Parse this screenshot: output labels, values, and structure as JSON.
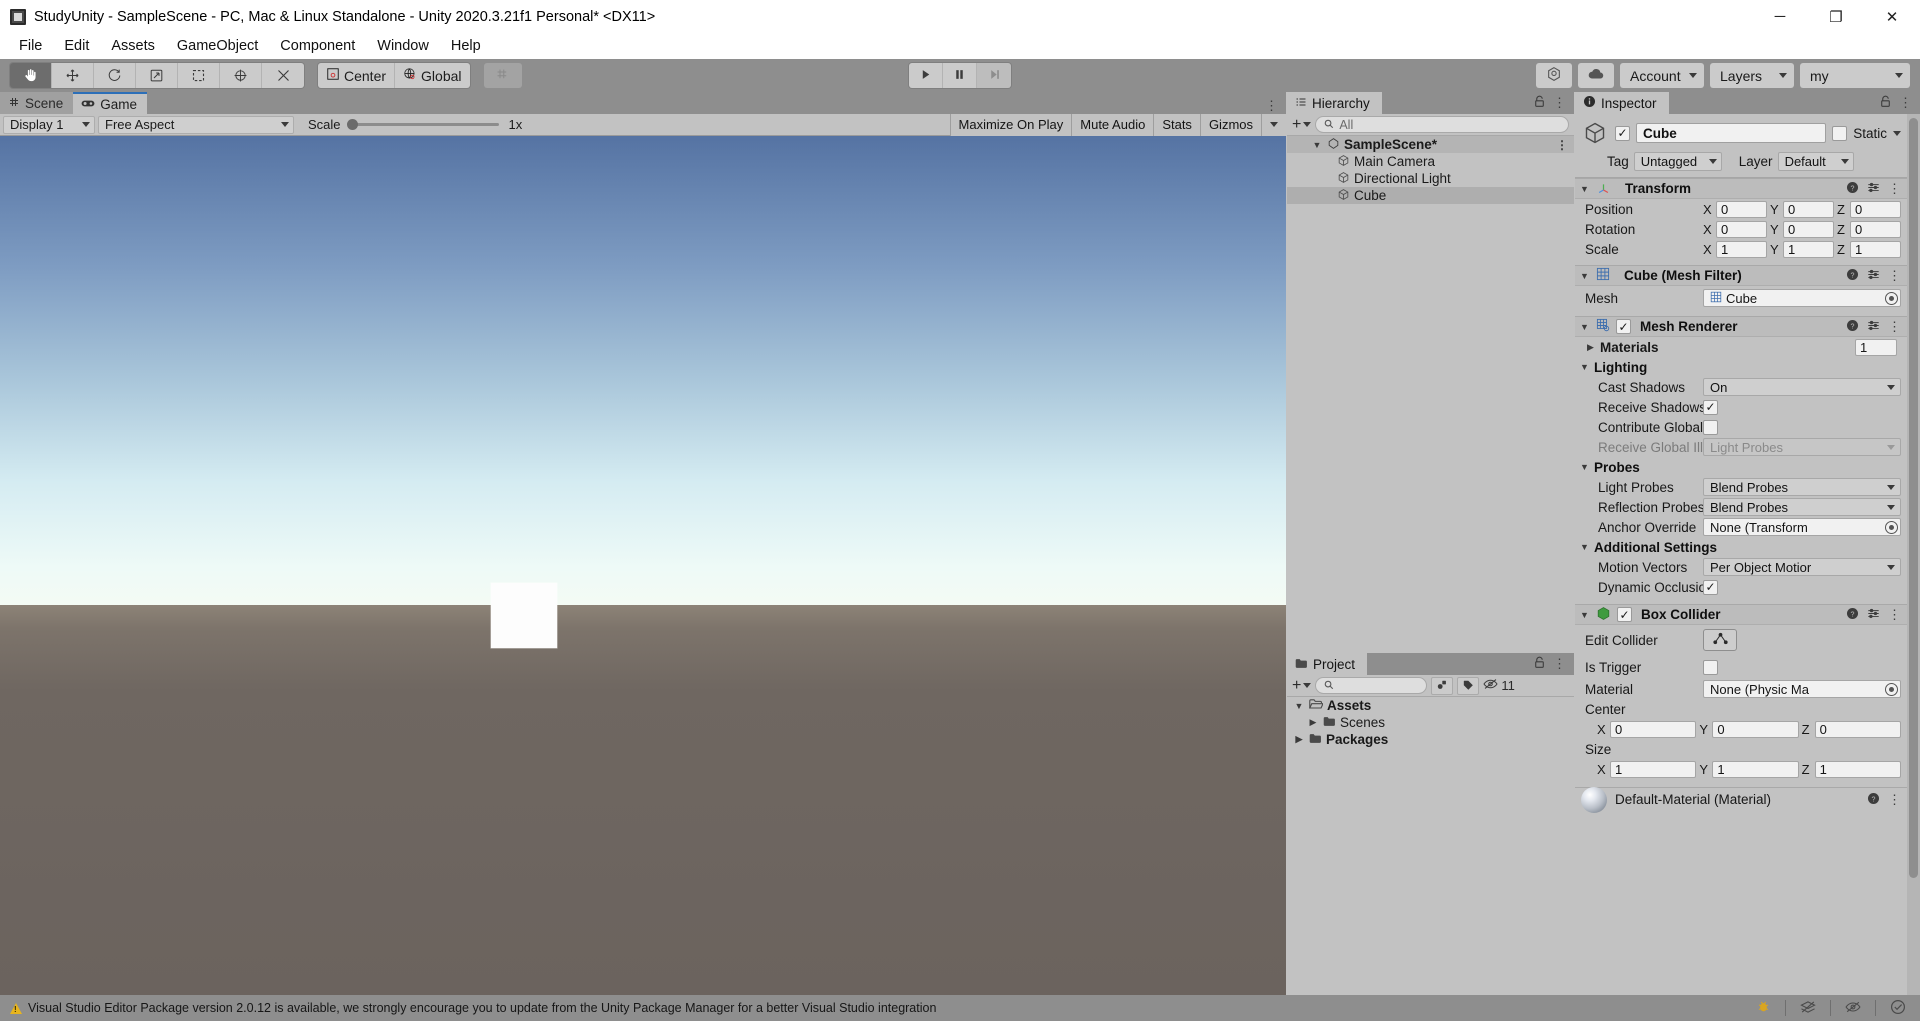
{
  "window": {
    "title": "StudyUnity - SampleScene - PC, Mac & Linux Standalone - Unity 2020.3.21f1 Personal* <DX11>",
    "minimize": "─",
    "maximize": "❐",
    "close": "✕"
  },
  "menubar": {
    "items": [
      {
        "label": "File"
      },
      {
        "label": "Edit"
      },
      {
        "label": "Assets"
      },
      {
        "label": "GameObject"
      },
      {
        "label": "Component"
      },
      {
        "label": "Window"
      },
      {
        "label": "Help"
      }
    ]
  },
  "toolbar": {
    "tools": [
      {
        "name": "hand-tool",
        "active": true
      },
      {
        "name": "move-tool",
        "active": false
      },
      {
        "name": "rotate-tool",
        "active": false
      },
      {
        "name": "scale-tool",
        "active": false
      },
      {
        "name": "rect-tool",
        "active": false
      },
      {
        "name": "transform-tool",
        "active": false
      },
      {
        "name": "custom-editor-tool",
        "active": false
      }
    ],
    "pivot_label": "Center",
    "orientation_label": "Global",
    "grid_snap": "grid-snapping-icon",
    "play": "play-button",
    "pause": "pause-button",
    "step": "step-button",
    "collab_icon": "unity-collab-icon",
    "cloud_icon": "cloud-icon",
    "account_label": "Account",
    "layers_label": "Layers",
    "layout_label": "my"
  },
  "game_pane": {
    "tabs": [
      {
        "label": "Scene",
        "icon": "scene-grid-icon",
        "active": false
      },
      {
        "label": "Game",
        "icon": "gamepad-icon",
        "active": true
      }
    ],
    "display_select": "Display 1",
    "aspect_select": "Free Aspect",
    "scale_label": "Scale",
    "scale_value": "1x",
    "maximize_on_play": "Maximize On Play",
    "mute_audio": "Mute Audio",
    "stats": "Stats",
    "gizmos": "Gizmos"
  },
  "hierarchy": {
    "title": "Hierarchy",
    "search_placeholder": "All",
    "tree": [
      {
        "label": "SampleScene*",
        "depth": 0,
        "kind": "scene",
        "expanded": true,
        "selected": false
      },
      {
        "label": "Main Camera",
        "depth": 1,
        "kind": "object",
        "expanded": false,
        "selected": false
      },
      {
        "label": "Directional Light",
        "depth": 1,
        "kind": "object",
        "expanded": false,
        "selected": false
      },
      {
        "label": "Cube",
        "depth": 1,
        "kind": "object",
        "expanded": false,
        "selected": true
      }
    ]
  },
  "project": {
    "title": "Project",
    "search_placeholder": "",
    "hidden_count": "11",
    "tree": [
      {
        "label": "Assets",
        "depth": 0,
        "expanded": true,
        "bold": true
      },
      {
        "label": "Scenes",
        "depth": 1,
        "expanded": false,
        "bold": false
      },
      {
        "label": "Packages",
        "depth": 0,
        "expanded": false,
        "bold": true
      }
    ]
  },
  "inspector": {
    "title": "Inspector",
    "object": {
      "enabled": true,
      "name": "Cube",
      "static_label": "Static",
      "static_checked": false,
      "tag_label": "Tag",
      "tag_value": "Untagged",
      "layer_label": "Layer",
      "layer_value": "Default"
    },
    "transform": {
      "title": "Transform",
      "rows": [
        {
          "label": "Position",
          "x": "0",
          "y": "0",
          "z": "0"
        },
        {
          "label": "Rotation",
          "x": "0",
          "y": "0",
          "z": "0"
        },
        {
          "label": "Scale",
          "x": "1",
          "y": "1",
          "z": "1"
        }
      ]
    },
    "mesh_filter": {
      "title": "Cube (Mesh Filter)",
      "mesh_label": "Mesh",
      "mesh_value": "Cube"
    },
    "mesh_renderer": {
      "title": "Mesh Renderer",
      "enabled": true,
      "materials_label": "Materials",
      "materials_count": "1",
      "lighting_label": "Lighting",
      "cast_shadows_label": "Cast Shadows",
      "cast_shadows_value": "On",
      "receive_shadows_label": "Receive Shadows",
      "receive_shadows_checked": true,
      "contribute_global_label": "Contribute Global",
      "contribute_global_checked": false,
      "receive_gi_label": "Receive Global Illu",
      "receive_gi_value": "Light Probes",
      "probes_label": "Probes",
      "light_probes_label": "Light Probes",
      "light_probes_value": "Blend Probes",
      "reflection_probes_label": "Reflection Probes",
      "reflection_probes_value": "Blend Probes",
      "anchor_override_label": "Anchor Override",
      "anchor_override_value": "None (Transform",
      "additional_settings_label": "Additional Settings",
      "motion_vectors_label": "Motion Vectors",
      "motion_vectors_value": "Per Object Motior",
      "dynamic_occlusion_label": "Dynamic Occlusio",
      "dynamic_occlusion_checked": true
    },
    "box_collider": {
      "title": "Box Collider",
      "enabled": true,
      "edit_collider_label": "Edit Collider",
      "is_trigger_label": "Is Trigger",
      "is_trigger_checked": false,
      "material_label": "Material",
      "material_value": "None (Physic Ma",
      "center_label": "Center",
      "center": {
        "x": "0",
        "y": "0",
        "z": "0"
      },
      "size_label": "Size",
      "size": {
        "x": "1",
        "y": "1",
        "z": "1"
      }
    },
    "material_footer": {
      "title": "Default-Material (Material)"
    }
  },
  "statusbar": {
    "message": "Visual Studio Editor Package version 2.0.12 is available, we strongly encourage you to update from the Unity Package Manager for a better Visual Studio integration"
  },
  "colors": {
    "accent_tab": "#2c6fb8",
    "panel_bg": "#c2c2c2",
    "chrome_bg": "#8e8e8e",
    "warning": "#e8b51e"
  }
}
